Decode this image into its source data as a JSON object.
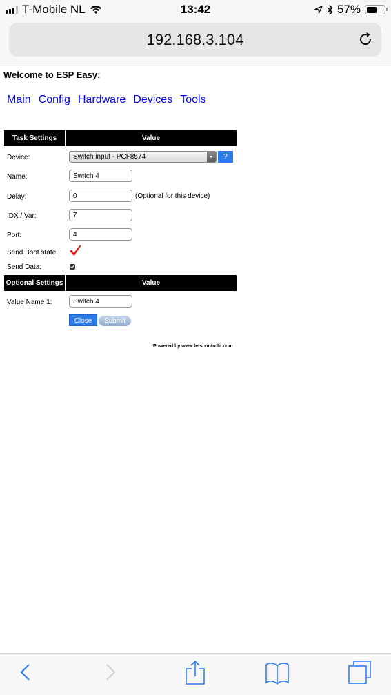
{
  "status_bar": {
    "carrier": "T-Mobile NL",
    "time": "13:42",
    "battery_percent": "57%",
    "battery_level": 0.57,
    "icons": [
      "signal-icon",
      "wifi-icon",
      "location-icon",
      "bluetooth-icon",
      "battery-icon"
    ]
  },
  "browser": {
    "url": "192.168.3.104",
    "reload_icon": "reload-icon",
    "toolbar": {
      "back": "back-icon",
      "forward": "forward-icon",
      "share": "share-icon",
      "bookmarks": "bookmarks-icon",
      "tabs": "tabs-icon"
    }
  },
  "page": {
    "welcome": "Welcome to ESP Easy:",
    "nav": [
      "Main",
      "Config",
      "Hardware",
      "Devices",
      "Tools"
    ],
    "task_settings": {
      "header_col1": "Task Settings",
      "header_col2": "Value",
      "device_label": "Device:",
      "device_value": "Switch input - PCF8574",
      "help_label": "?",
      "name_label": "Name:",
      "name_value": "Switch 4",
      "delay_label": "Delay:",
      "delay_value": "0",
      "delay_note": "(Optional for this device)",
      "idx_label": "IDX / Var:",
      "idx_value": "7",
      "port_label": "Port:",
      "port_value": "4",
      "boot_label": "Send Boot state:",
      "boot_checked": true,
      "data_label": "Send Data:",
      "data_checked": true
    },
    "optional_settings": {
      "header_col1": "Optional Settings",
      "header_col2": "Value",
      "value_name_label": "Value Name 1:",
      "value_name_value": "Switch 4"
    },
    "buttons": {
      "close": "Close",
      "submit": "Submit"
    },
    "footer": "Powered by www.letscontrolit.com"
  },
  "colors": {
    "link": "#0000ee",
    "button_blue": "#2e7ae6",
    "checkmark_red": "#d9141b",
    "ios_blue": "#2f7cf6"
  }
}
